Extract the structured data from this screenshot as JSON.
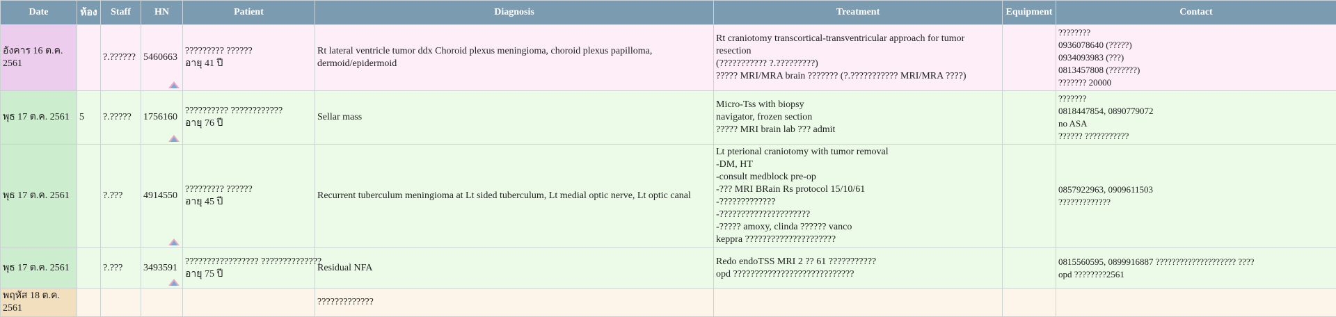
{
  "columns": [
    "Date",
    "ห้อง",
    "Staff",
    "HN",
    "Patient",
    "Diagnosis",
    "Treatment",
    "Equipment",
    "Contact"
  ],
  "rows": [
    {
      "date": "อังคาร 16 ต.ค. 2561",
      "room": "",
      "staff": "?.??????",
      "hn": "5460663",
      "patient_name": "????????? ??????",
      "patient_age": "อายุ 41 ปี",
      "diagnosis": "Rt lateral ventricle tumor ddx Choroid plexus meningioma, choroid plexus papilloma, dermoid/epidermoid",
      "treatment": [
        "Rt craniotomy transcortical-transventricular approach for tumor resection",
        "(??????????? ?.?????????)",
        "????? MRI/MRA brain ??????? (?.??????????? MRI/MRA ????)"
      ],
      "equipment": "",
      "contact": [
        "????????",
        "0936078640 (?????)",
        "0934093983 (???)",
        "0813457808 (???????)",
        "??????? 20000"
      ]
    },
    {
      "date": "พุธ 17 ต.ค. 2561",
      "room": "5",
      "staff": "?.?????",
      "hn": "1756160",
      "patient_name": "?????????? ????????????",
      "patient_age": "อายุ 76 ปี",
      "diagnosis": "Sellar mass",
      "treatment": [
        "Micro-Tss with biopsy",
        "navigator, frozen section",
        "????? MRI brain lab ??? admit"
      ],
      "equipment": "",
      "contact": [
        "???????",
        "0818447854, 0890779072",
        "no ASA",
        "?????? ???????????"
      ]
    },
    {
      "date": "พุธ 17 ต.ค. 2561",
      "room": "",
      "staff": "?.???",
      "hn": "4914550",
      "patient_name": "????????? ??????",
      "patient_age": "อายุ 45 ปี",
      "diagnosis": "Recurrent tuberculum meningioma at Lt sided tuberculum, Lt medial optic nerve, Lt optic canal",
      "treatment": [
        "Lt pterional craniotomy with tumor removal",
        "-DM, HT",
        "-consult medblock pre-op",
        "-??? MRI BRain Rs protocol 15/10/61",
        "-?????????????",
        "-?????????????????????",
        "-????? amoxy, clinda ?????? vanco",
        "keppra ?????????????????????"
      ],
      "equipment": "",
      "contact": [
        "0857922963, 0909611503",
        "?????????????"
      ]
    },
    {
      "date": "พุธ 17 ต.ค. 2561",
      "room": "",
      "staff": "?.???",
      "hn": "3493591",
      "patient_name": "????????????????? ??????????????",
      "patient_age": "อายุ 75 ปี",
      "diagnosis": "Residual NFA",
      "treatment": [
        "Redo endoTSS MRI 2 ?? 61 ???????????",
        "opd ????????????????????????????"
      ],
      "equipment": "",
      "contact": [
        "0815560595, 0899916887 ???????????????????? ????",
        "opd ????????2561"
      ]
    },
    {
      "date": "พฤหัส 18 ต.ค. 2561",
      "room": "",
      "staff": "",
      "hn": "",
      "patient_name": "",
      "patient_age": "",
      "diagnosis": "?????????????",
      "treatment": [],
      "equipment": "",
      "contact": []
    }
  ],
  "icons": {
    "hn": "patient-link-icon"
  },
  "colors": {
    "header": "#7a9bb0",
    "row_pink": "#fdeef7",
    "row_green": "#ecfbe8",
    "row_peach": "#fef5ea"
  }
}
